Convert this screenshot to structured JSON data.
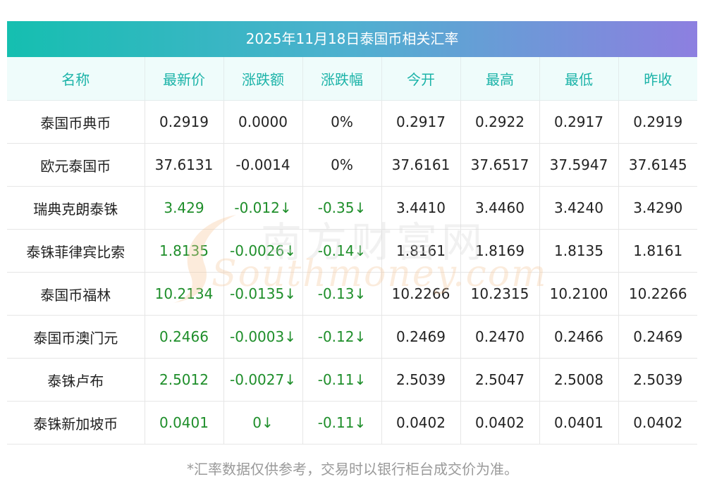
{
  "title": "2025年11月18日泰国币相关汇率",
  "headers": [
    "名称",
    "最新价",
    "涨跌额",
    "涨跌幅",
    "今开",
    "最高",
    "最低",
    "昨收"
  ],
  "rows": [
    {
      "name": "泰国币典币",
      "price": "0.2919",
      "change": "0.0000",
      "pct": "0%",
      "open": "0.2917",
      "high": "0.2922",
      "low": "0.2917",
      "prev": "0.2919",
      "down": false
    },
    {
      "name": "欧元泰国币",
      "price": "37.6131",
      "change": "-0.0014",
      "pct": "0%",
      "open": "37.6161",
      "high": "37.6517",
      "low": "37.5947",
      "prev": "37.6145",
      "down": false
    },
    {
      "name": "瑞典克朗泰铢",
      "price": "3.429",
      "change": "-0.012↓",
      "pct": "-0.35↓",
      "open": "3.4410",
      "high": "3.4460",
      "low": "3.4240",
      "prev": "3.4290",
      "down": true
    },
    {
      "name": "泰铢菲律宾比索",
      "price": "1.8135",
      "change": "-0.0026↓",
      "pct": "-0.14↓",
      "open": "1.8161",
      "high": "1.8169",
      "low": "1.8135",
      "prev": "1.8161",
      "down": true
    },
    {
      "name": "泰国币福林",
      "price": "10.2134",
      "change": "-0.0135↓",
      "pct": "-0.13↓",
      "open": "10.2266",
      "high": "10.2315",
      "low": "10.2100",
      "prev": "10.2266",
      "down": true
    },
    {
      "name": "泰国币澳门元",
      "price": "0.2466",
      "change": "-0.0003↓",
      "pct": "-0.12↓",
      "open": "0.2469",
      "high": "0.2470",
      "low": "0.2466",
      "prev": "0.2469",
      "down": true
    },
    {
      "name": "泰铢卢布",
      "price": "2.5012",
      "change": "-0.0027↓",
      "pct": "-0.11↓",
      "open": "2.5039",
      "high": "2.5047",
      "low": "2.5008",
      "prev": "2.5039",
      "down": true
    },
    {
      "name": "泰铢新加坡币",
      "price": "0.0401",
      "change": "0↓",
      "pct": "-0.11↓",
      "open": "0.0402",
      "high": "0.0402",
      "low": "0.0401",
      "prev": "0.0402",
      "down": true
    }
  ],
  "watermark": {
    "cn": "南方财富网",
    "en": "Southmoney.com"
  },
  "footnote": "*汇率数据仅供参考，交易时以银行柜台成交价为准。",
  "colors": {
    "title_start": "#15bfb0",
    "title_end": "#8d7fe0",
    "header_text": "#1bb3a8",
    "down": "#1e8e2a"
  }
}
